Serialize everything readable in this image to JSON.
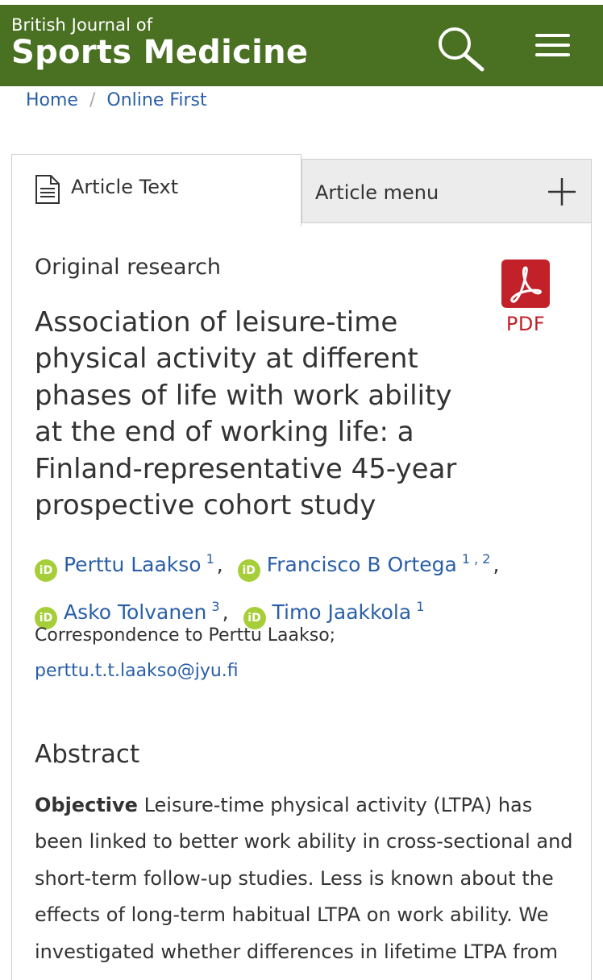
{
  "header": {
    "journal_small": "British Journal of",
    "journal_big": "Sports Medicine"
  },
  "breadcrumb": {
    "home": "Home",
    "separator": "/",
    "current": "Online First"
  },
  "tabs": {
    "article_text": "Article Text",
    "article_menu": "Article menu"
  },
  "article": {
    "type": "Original research",
    "pdf_label": "PDF",
    "title": "Association of leisure-time physical activity at different phases of life with work ability at the end of working life: a Finland-representative 45-year prospective cohort study",
    "authors": [
      {
        "name": "Perttu Laakso",
        "affil": "1"
      },
      {
        "name": "Francisco B Ortega",
        "affil": "1 , 2"
      },
      {
        "name": "Asko Tolvanen",
        "affil": "3"
      },
      {
        "name": "Timo Jaakkola",
        "affil": "1"
      }
    ],
    "orcid_label": "iD",
    "correspondence": "Correspondence to Perttu Laakso;",
    "email": "perttu.t.t.laakso@jyu.fi"
  },
  "abstract": {
    "heading": "Abstract",
    "objective_label": "Objective",
    "objective_text": " Leisure-time physical activity (LTPA) has been linked to better work ability in cross-sectional and short-term follow-up studies. Less is known about the effects of long-term habitual LTPA on work ability. We investigated whether differences in lifetime LTPA from"
  },
  "colors": {
    "brand_green": "#4a7022",
    "link_blue": "#2a5fa8",
    "orcid_green": "#a6ce39",
    "pdf_red": "#c3212a"
  }
}
